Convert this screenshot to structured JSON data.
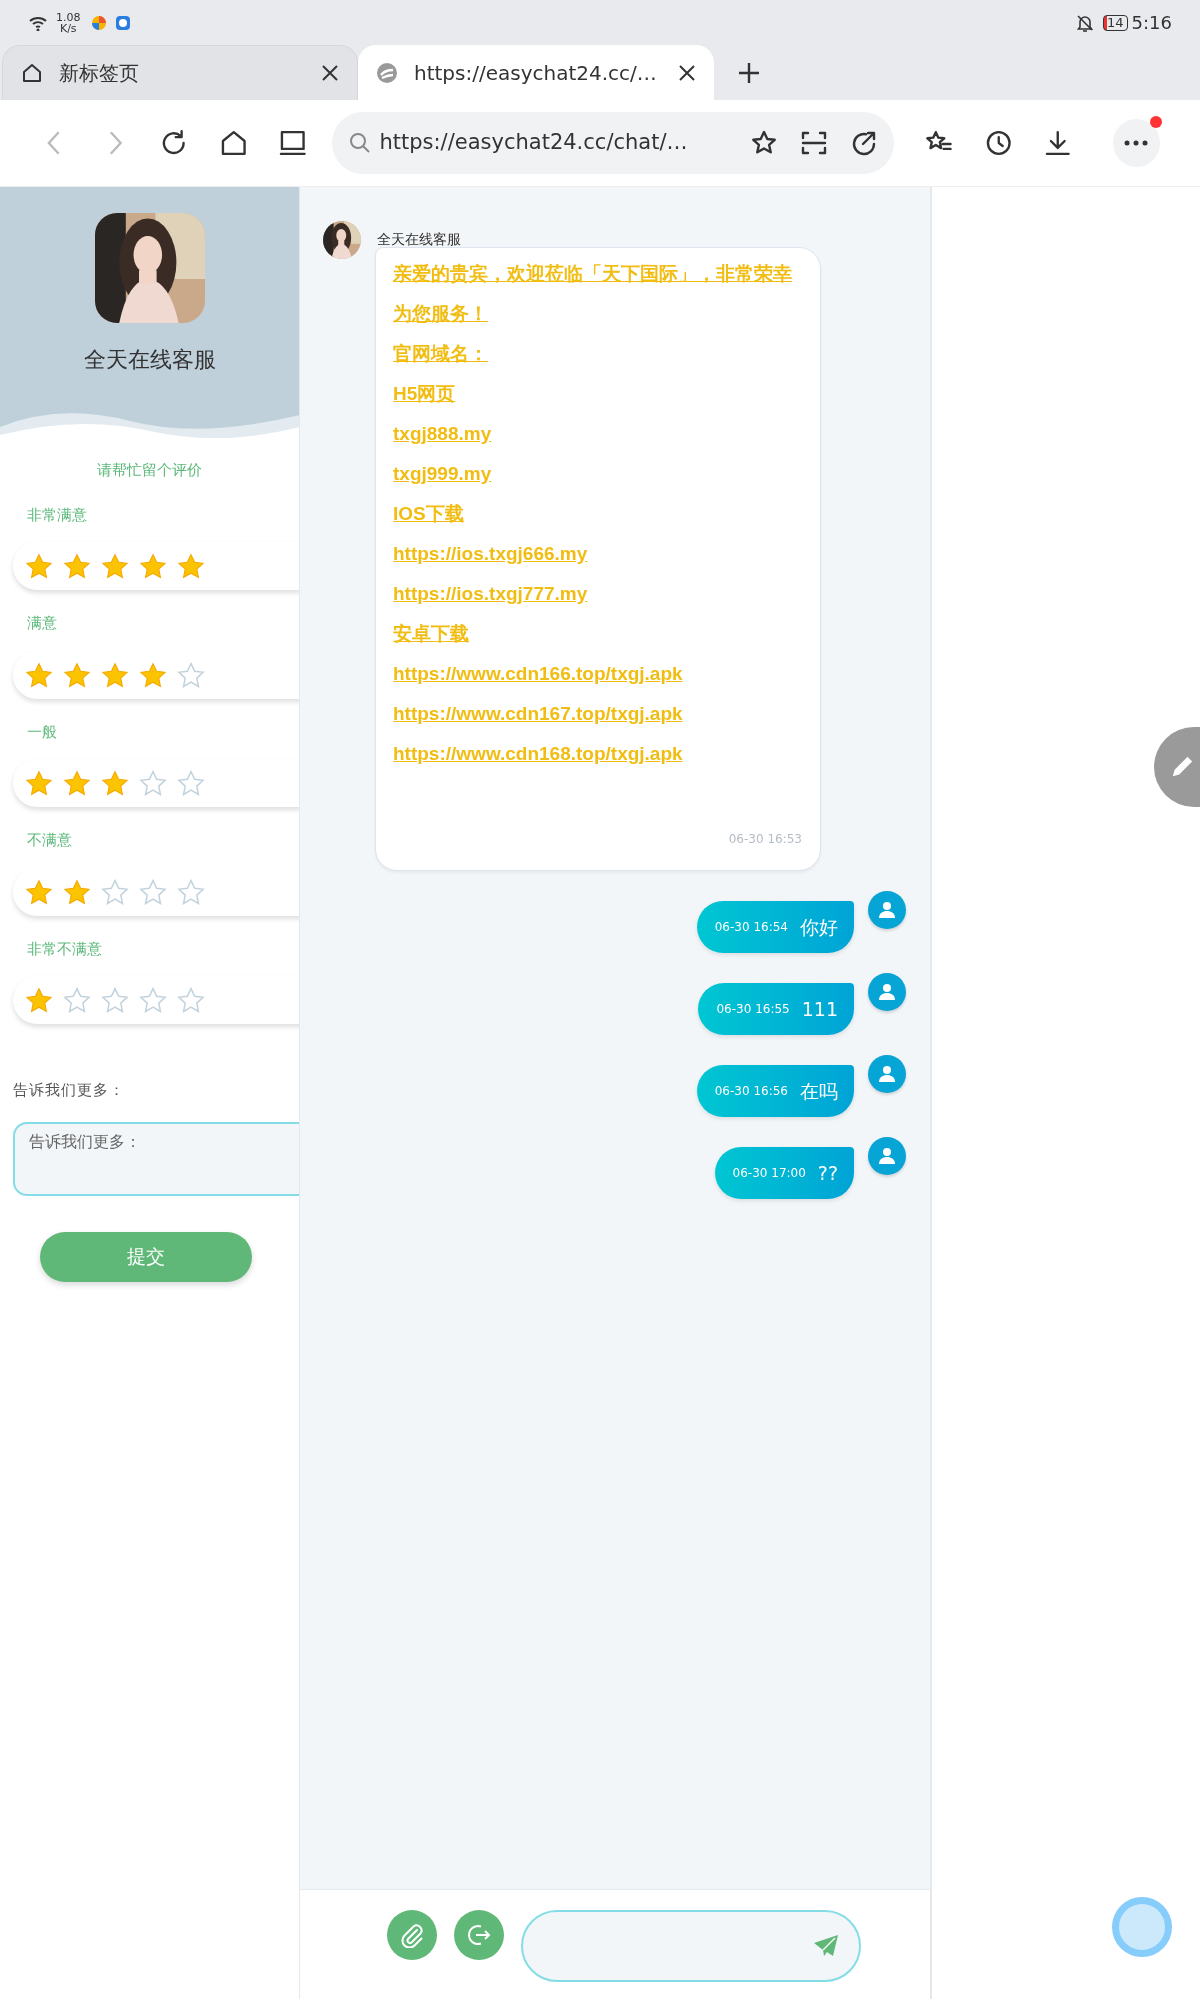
{
  "status_bar": {
    "speed_value": "1.08",
    "speed_unit": "K/s",
    "battery": "14",
    "time": "5:16"
  },
  "browser": {
    "tabs": [
      {
        "title": "新标签页",
        "selected": false
      },
      {
        "title": "https://easychat24.cc/…",
        "selected": true
      }
    ],
    "address": "https://easychat24.cc/chat/…",
    "menu_notification": true
  },
  "sidebar": {
    "agent_name": "全天在线客服",
    "rating_prompt": "请帮忙留个评价",
    "ratings": [
      {
        "label": "非常满意",
        "stars": 5
      },
      {
        "label": "满意",
        "stars": 4
      },
      {
        "label": "一般",
        "stars": 3
      },
      {
        "label": "不满意",
        "stars": 2
      },
      {
        "label": "非常不满意",
        "stars": 1
      }
    ],
    "comment_label": "告诉我们更多：",
    "comment_placeholder": "告诉我们更多：",
    "submit": "提交"
  },
  "chat": {
    "messages": [
      {
        "kind": "agent",
        "sender": "全天在线客服",
        "lines": [
          "亲爱的贵宾，欢迎莅临「天下国际」，非常荣幸为您服务！",
          "官网域名：",
          "H5网页",
          "txgj888.my",
          "txgj999.my",
          "IOS下载",
          "https://ios.txgj666.my",
          "https://ios.txgj777.my",
          "安卓下载",
          "https://www.cdn166.top/txgj.apk",
          "https://www.cdn167.top/txgj.apk",
          "https://www.cdn168.top/txgj.apk"
        ],
        "time": "06-30 16:53"
      },
      {
        "kind": "user",
        "time": "06-30 16:54",
        "text": "你好"
      },
      {
        "kind": "user",
        "time": "06-30 16:55",
        "text": "111"
      },
      {
        "kind": "user",
        "time": "06-30 16:56",
        "text": "在吗"
      },
      {
        "kind": "user",
        "time": "06-30 17:00",
        "text": "??"
      }
    ]
  }
}
